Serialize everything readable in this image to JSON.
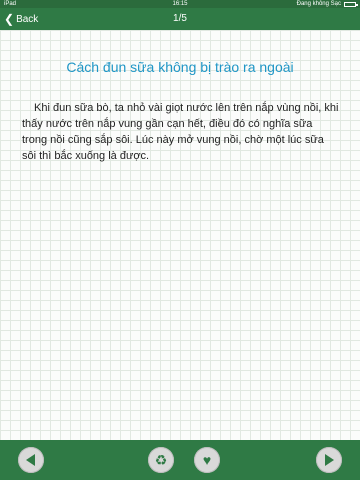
{
  "status": {
    "device": "iPad",
    "time": "16:15",
    "charging": "Đang không Sạc"
  },
  "nav": {
    "back_label": "Back",
    "page": "1/5"
  },
  "article": {
    "title": "Cách đun sữa không bị trào ra ngoài",
    "body": "Khi đun sữa bò, ta nhỏ vài giọt nước lên trên nắp vùng nồi, khi thấy nước trên nắp vung gần cạn hết, điều đó có nghĩa sữa trong nồi cũng sắp sôi. Lúc này mở vung nồi, chờ một lúc sữa sôi thì bắc xuống là được."
  },
  "toolbar": {
    "prev_icon": "triangle-left-icon",
    "share_icon": "recycle-icon",
    "favorite_icon": "heart-icon",
    "next_icon": "triangle-right-icon"
  },
  "colors": {
    "bar_green": "#2f7a45",
    "title_blue": "#1f96c6"
  }
}
